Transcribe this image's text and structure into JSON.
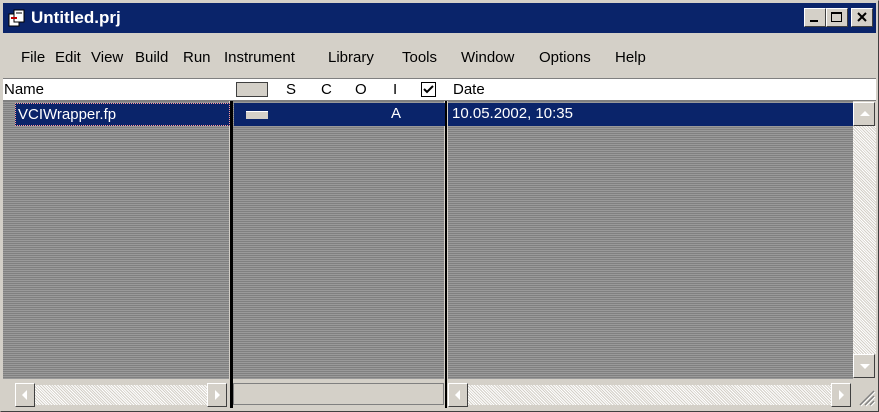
{
  "window": {
    "title": "Untitled.prj"
  },
  "menu": [
    {
      "label": "File"
    },
    {
      "label": "Edit"
    },
    {
      "label": "View"
    },
    {
      "label": "Build"
    },
    {
      "label": "Run"
    },
    {
      "label": "Instrument"
    },
    {
      "label": "Library"
    },
    {
      "label": "Tools"
    },
    {
      "label": "Window"
    },
    {
      "label": "Options"
    },
    {
      "label": "Help"
    }
  ],
  "columns": {
    "name": "Name",
    "s": "S",
    "c": "C",
    "o": "O",
    "i": "I",
    "date": "Date"
  },
  "files": [
    {
      "name": "VCIWrapper.fp",
      "flag": "A",
      "date": "10.05.2002, 10:35"
    }
  ],
  "icons": [
    "project-icon",
    "minimize-icon",
    "maximize-icon",
    "close-icon",
    "checkbox-checked-icon",
    "scroll-arrow-icons",
    "resize-grip-icon"
  ]
}
